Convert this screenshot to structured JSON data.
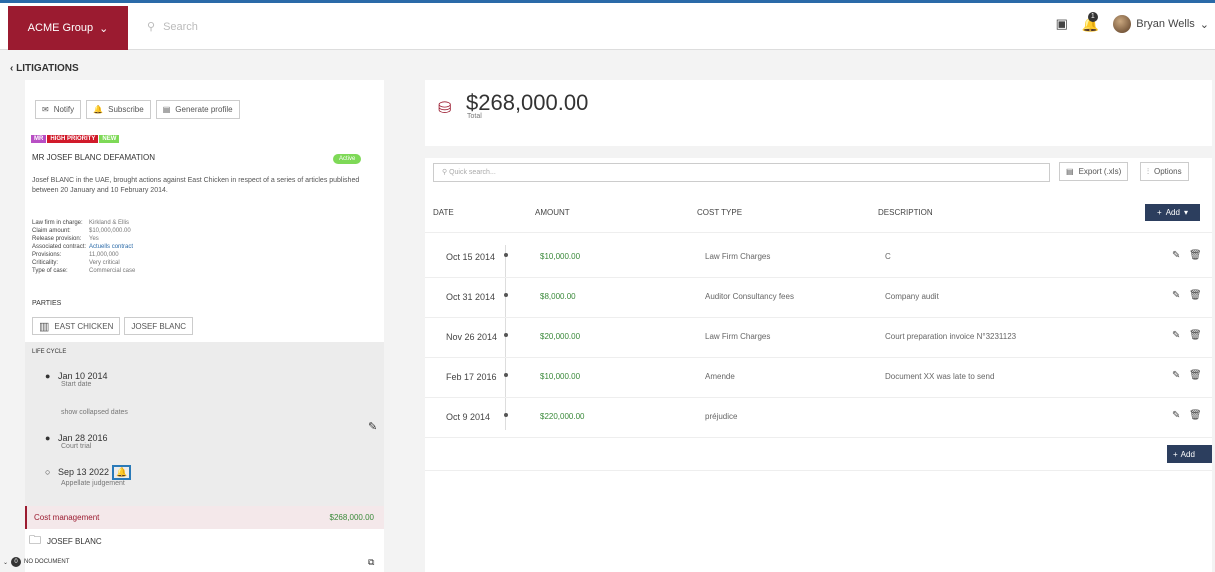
{
  "header": {
    "org": "ACME Group",
    "search_placeholder": "Search",
    "user": "Bryan Wells",
    "notif_count": "1"
  },
  "breadcrumb": "LITIGATIONS",
  "case": {
    "actions": [
      "Notify",
      "Subscribe",
      "Generate profile"
    ],
    "tags": [
      {
        "label": "MR",
        "color": "#b84fc4"
      },
      {
        "label": "HIGH PRIORITY",
        "color": "#d11a2a"
      },
      {
        "label": "NEW",
        "color": "#7ed957"
      }
    ],
    "title": "MR JOSEF BLANC DEFAMATION",
    "status": "Active",
    "description": "Josef BLANC in the UAE, brought actions against East Chicken in respect of a series of articles published between 20 January and 10 February 2014.",
    "details": [
      [
        "Law firm in charge:",
        "Kirkland & Ellis"
      ],
      [
        "Claim amount:",
        "$10,000,000.00"
      ],
      [
        "Release provision:",
        "Yes"
      ],
      [
        "Associated contract:",
        "Actuells contract"
      ],
      [
        "Provisions:",
        "11,000,000"
      ],
      [
        "Criticality:",
        "Very critical"
      ],
      [
        "Type of case:",
        "Commercial case"
      ]
    ],
    "parties_label": "PARTIES",
    "parties": [
      "EAST CHICKEN",
      "JOSEF BLANC"
    ],
    "lifecycle_label": "LIFE CYCLE",
    "lifecycle": [
      {
        "date": "Jan 10 2014",
        "label": "Start date"
      },
      {
        "date": "Jan 28 2016",
        "label": "Court trial"
      },
      {
        "date": "Sep 13 2022",
        "label": "Appellate judgement"
      }
    ],
    "collapsed": "show collapsed dates",
    "cost_label": "Cost management",
    "cost_value": "$268,000.00",
    "party_doc": "JOSEF BLANC",
    "no_doc": "NO DOCUMENT",
    "doc_count": "0"
  },
  "summary": {
    "total": "$268,000.00",
    "total_label": "Total"
  },
  "table": {
    "search_placeholder": "Quick search...",
    "export": "Export (.xls)",
    "options": "Options",
    "add": "Add",
    "add_bottom": "Add",
    "headers": [
      "DATE",
      "AMOUNT",
      "COST TYPE",
      "DESCRIPTION"
    ],
    "rows": [
      {
        "date": "Oct 15 2014",
        "amount": "$10,000.00",
        "type": "Law Firm Charges",
        "desc": "C"
      },
      {
        "date": "Oct 31 2014",
        "amount": "$8,000.00",
        "type": "Auditor Consultancy fees",
        "desc": "Company audit"
      },
      {
        "date": "Nov 26 2014",
        "amount": "$20,000.00",
        "type": "Law Firm Charges",
        "desc": "Court preparation invoice N°3231123"
      },
      {
        "date": "Feb 17 2016",
        "amount": "$10,000.00",
        "type": "Amende",
        "desc": "Document XX was late to send"
      },
      {
        "date": "Oct 9 2014",
        "amount": "$220,000.00",
        "type": "préjudice",
        "desc": ""
      }
    ]
  }
}
